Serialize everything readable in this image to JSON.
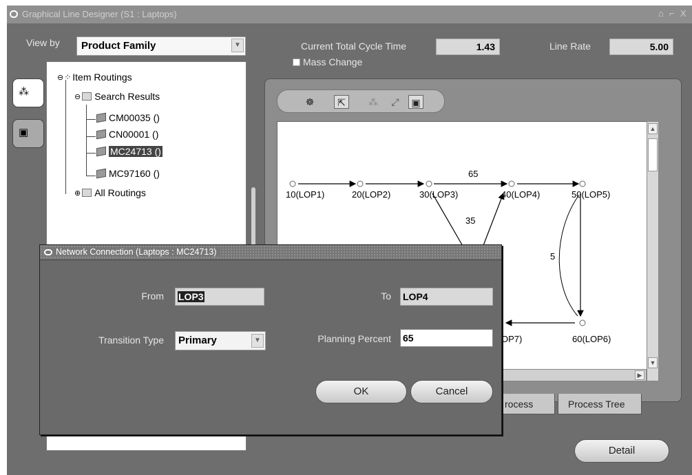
{
  "window": {
    "title": "Graphical Line Designer (S1 : Laptops)",
    "controls": [
      "⌂",
      "⌐",
      "X"
    ]
  },
  "header": {
    "view_by_label": "View by",
    "view_by_value": "Product Family",
    "cycle_time_label": "Current Total Cycle Time",
    "cycle_time_value": "1.43",
    "line_rate_label": "Line Rate",
    "line_rate_value": "5.00",
    "mass_change_label": "Mass Change"
  },
  "tree": {
    "root": "Item Routings",
    "search_results": "Search Results",
    "items": [
      "CM00035 ()",
      "CN00001 ()",
      "MC24713 ()",
      "MC97160 ()"
    ],
    "all_routings": "All Routings",
    "selected_index": 2
  },
  "toolbar": {
    "icons": [
      "palette-icon",
      "pointer-icon",
      "node-icon",
      "link-icon",
      "properties-icon"
    ]
  },
  "network": {
    "nodes": [
      {
        "id": "10",
        "label": "10(LOP1)"
      },
      {
        "id": "20",
        "label": "20(LOP2)"
      },
      {
        "id": "30",
        "label": "30(LOP3)"
      },
      {
        "id": "40",
        "label": "40(LOP4)"
      },
      {
        "id": "50",
        "label": "50(LOP5)"
      },
      {
        "id": "60",
        "label": "60(LOP6)"
      },
      {
        "id": "70",
        "label": "OP7)"
      }
    ],
    "edge_labels": {
      "e30_40": "65",
      "e30_down": "35",
      "e50_60": "5"
    }
  },
  "bottom_tabs": {
    "process": "rocess",
    "process_tree": "Process Tree"
  },
  "detail_button": "Detail",
  "dialog": {
    "title": "Network Connection (Laptops : MC24713)",
    "from_label": "From",
    "from_value": "LOP3",
    "to_label": "To",
    "to_value": "LOP4",
    "transition_type_label": "Transition Type",
    "transition_type_value": "Primary",
    "planning_percent_label": "Planning Percent",
    "planning_percent_value": "65",
    "ok_label": "OK",
    "cancel_label": "Cancel"
  }
}
